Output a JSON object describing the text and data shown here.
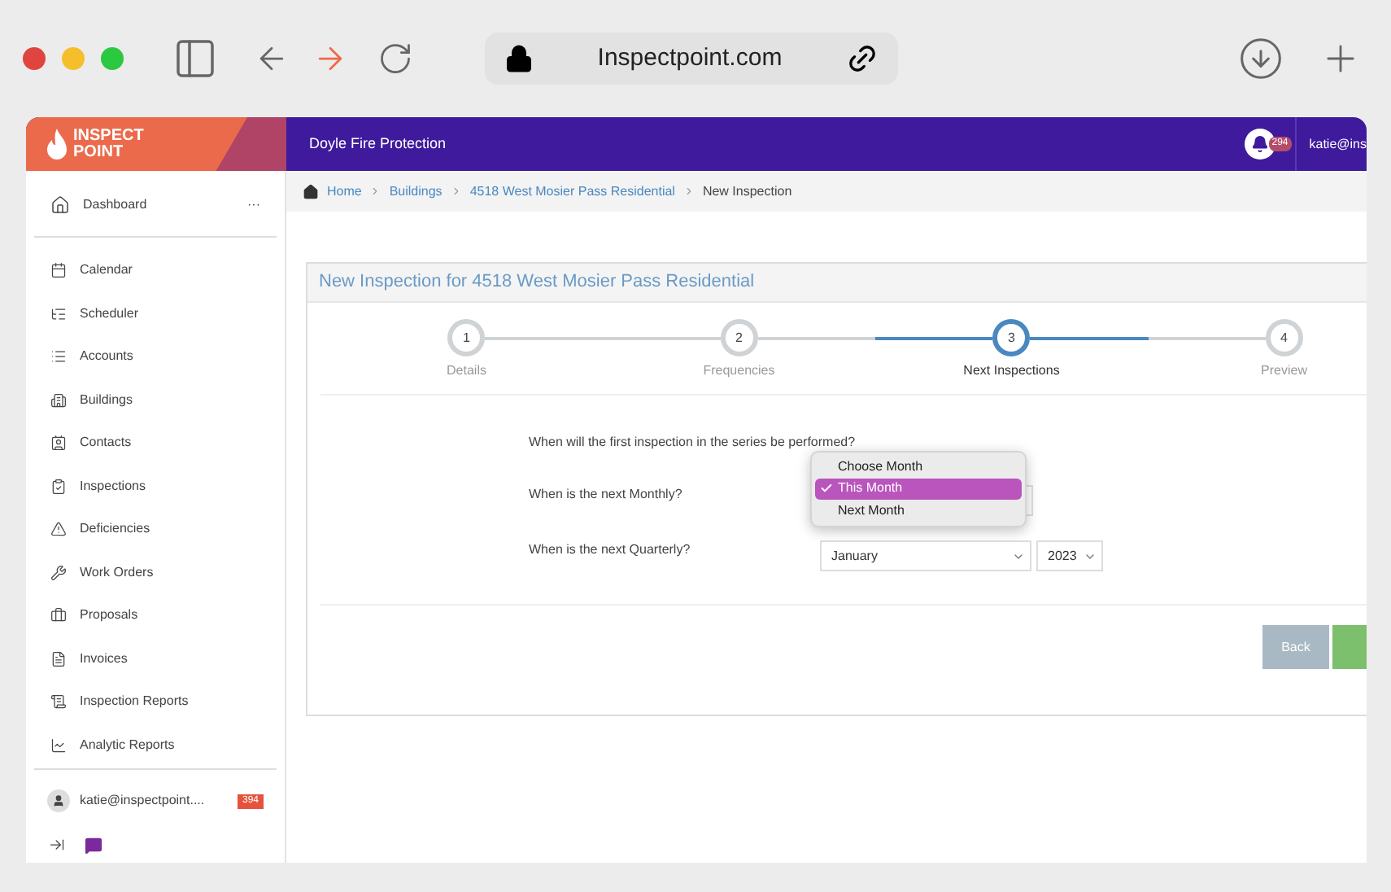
{
  "browser": {
    "url": "Inspectpoint.com"
  },
  "app_bar": {
    "logo": [
      "INSPECT",
      "POINT"
    ],
    "company": "Doyle Fire Protection",
    "notification_count": "294",
    "user": "katie@ins"
  },
  "sidebar": {
    "pinned": {
      "label": "Dashboard",
      "menu": "···"
    },
    "items": [
      {
        "label": "Calendar"
      },
      {
        "label": "Scheduler"
      },
      {
        "label": "Accounts"
      },
      {
        "label": "Buildings"
      },
      {
        "label": "Contacts"
      },
      {
        "label": "Inspections"
      },
      {
        "label": "Deficiencies"
      },
      {
        "label": "Work Orders"
      },
      {
        "label": "Proposals"
      },
      {
        "label": "Invoices"
      },
      {
        "label": "Inspection Reports"
      },
      {
        "label": "Analytic Reports"
      }
    ],
    "user": {
      "email": "katie@inspectpoint....",
      "badge": "394"
    }
  },
  "breadcrumbs": [
    {
      "label": "Home",
      "link": true
    },
    {
      "label": "Buildings",
      "link": true
    },
    {
      "label": "4518 West Mosier Pass Residential",
      "link": true
    },
    {
      "label": "New Inspection",
      "link": false
    }
  ],
  "panel": {
    "title": "New Inspection for 4518 West Mosier Pass Residential",
    "steps": [
      {
        "number": "1",
        "label": "Details",
        "selected": false
      },
      {
        "number": "2",
        "label": "Frequencies",
        "selected": false
      },
      {
        "number": "3",
        "label": "Next Inspections",
        "selected": true
      },
      {
        "number": "4",
        "label": "Preview",
        "selected": false
      }
    ],
    "question": "When will the first inspection in the series be performed?",
    "fields": [
      {
        "label": "When is the next Monthly?"
      },
      {
        "label": "When is the next Quarterly?",
        "month": "January",
        "year": "2023"
      }
    ],
    "dropdown": [
      {
        "label": "Choose Month",
        "selected": false
      },
      {
        "label": "This Month",
        "selected": true
      },
      {
        "label": "Next Month",
        "selected": false
      }
    ],
    "buttons": [
      {
        "label": "Back",
        "kind": "back"
      },
      {
        "kind": "next"
      }
    ]
  }
}
